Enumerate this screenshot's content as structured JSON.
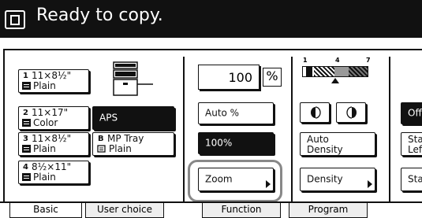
{
  "header": {
    "status": "Ready to copy."
  },
  "paper": [
    {
      "num": "1",
      "size": "11×8½\"",
      "type": "Plain"
    },
    {
      "num": "2",
      "size": "11×17\"",
      "type": "Color"
    },
    {
      "num": "3",
      "size": "11×8½\"",
      "type": "Plain"
    },
    {
      "num": "4",
      "size": "8½×11\"",
      "type": "Plain"
    }
  ],
  "aps": {
    "label": "APS"
  },
  "mp_tray": {
    "letter": "B",
    "name": "MP Tray",
    "type": "Plain"
  },
  "zoom": {
    "value": "100",
    "unit": "%",
    "auto_label": "Auto %",
    "preset_label": "100%",
    "zoom_label": "Zoom"
  },
  "density": {
    "scale": [
      "1",
      "4",
      "7"
    ],
    "auto_line1": "Auto",
    "auto_line2": "Density",
    "density_label": "Density",
    "lighter_icon": "half-circle-left-icon",
    "darker_icon": "half-circle-right-icon"
  },
  "right_column": {
    "off_label": "Off",
    "sta1_line1": "Sta",
    "sta1_line2": "Lef",
    "sta2": "Sta"
  },
  "tabs": [
    {
      "label": "Basic"
    },
    {
      "label": "User choice"
    },
    {
      "label": "Function"
    },
    {
      "label": "Program"
    }
  ],
  "colors": {
    "header_bg": "#111111",
    "highlight": "#888888"
  }
}
